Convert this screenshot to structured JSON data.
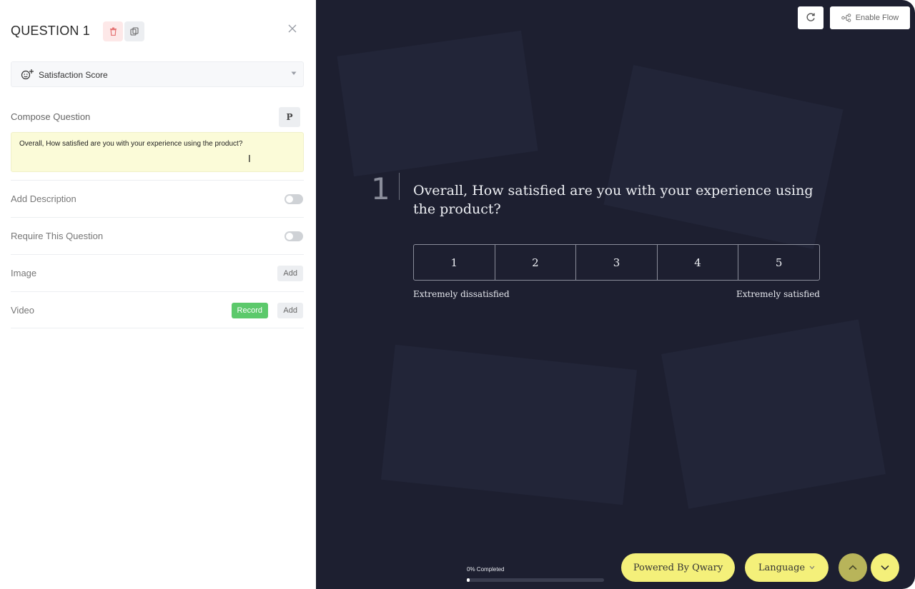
{
  "editor": {
    "title": "QUESTION 1",
    "question_type": "Satisfaction Score",
    "compose_label": "Compose Question",
    "format_button": "P",
    "question_text": "Overall, How satisfied are you with your experience using the product?",
    "options": [
      {
        "label": "Add Description"
      },
      {
        "label": "Require This Question"
      },
      {
        "label": "Image",
        "add_label": "Add"
      },
      {
        "label": "Video",
        "record_label": "Record",
        "add_label": "Add"
      }
    ]
  },
  "preview": {
    "enable_flow_label": "Enable Flow",
    "question_number": "1",
    "question_text": "Overall, How satisfied are you with your experience using the product?",
    "scale": [
      "1",
      "2",
      "3",
      "4",
      "5"
    ],
    "scale_low_label": "Extremely dissatisfied",
    "scale_high_label": "Extremely satisfied",
    "progress_text": "0% Completed",
    "progress_percent": 0,
    "powered_by": "Powered By Qwary",
    "language_label": "Language"
  },
  "colors": {
    "preview_background": "#1d1f30",
    "accent_yellow": "#f4f07a",
    "record_green": "#5cc96b",
    "delete_red": "#e57373",
    "compose_highlight": "#fbfbd8"
  },
  "icons": [
    "trash-icon",
    "copy-icon",
    "close-icon",
    "smiley-plus-icon",
    "caret-down-icon",
    "refresh-icon",
    "flow-icon",
    "chevron-up-icon",
    "chevron-down-icon",
    "text-cursor-icon"
  ]
}
